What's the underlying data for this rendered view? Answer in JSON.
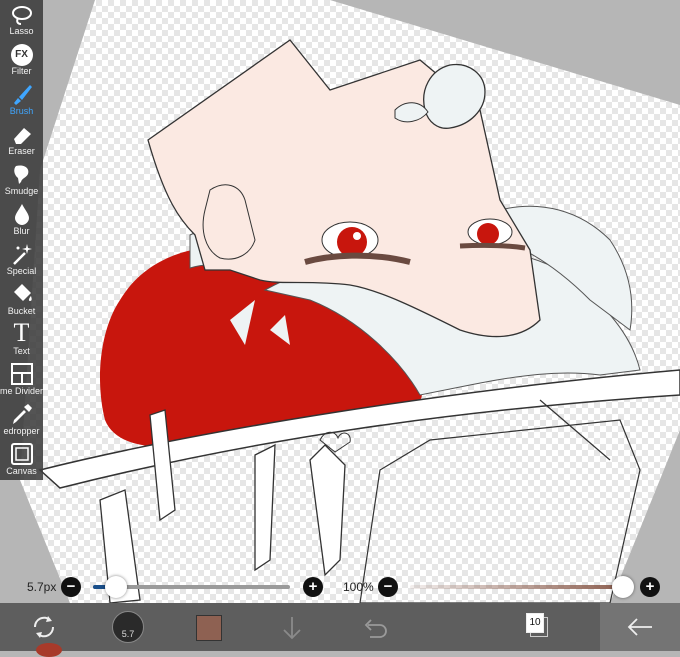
{
  "toolbar": {
    "items": [
      {
        "label": "Lasso",
        "icon": "lasso-icon"
      },
      {
        "label": "Filter",
        "icon": "fx-icon",
        "glyph": "FX"
      },
      {
        "label": "Brush",
        "icon": "brush-icon",
        "active": true
      },
      {
        "label": "Eraser",
        "icon": "eraser-icon"
      },
      {
        "label": "Smudge",
        "icon": "smudge-icon"
      },
      {
        "label": "Blur",
        "icon": "blur-icon"
      },
      {
        "label": "Special",
        "icon": "magic-wand-icon"
      },
      {
        "label": "Bucket",
        "icon": "bucket-icon"
      },
      {
        "label": "Text",
        "icon": "text-icon",
        "glyph": "T"
      },
      {
        "label": "me Divider",
        "icon": "frame-divider-icon"
      },
      {
        "label": "edropper",
        "icon": "eyedropper-icon"
      },
      {
        "label": "Canvas",
        "icon": "canvas-icon"
      }
    ],
    "active_color": "#3fa6ff"
  },
  "brush_size": {
    "label": "5.7px",
    "value": 5.7,
    "minus": "−",
    "plus": "+"
  },
  "opacity": {
    "label": "100%",
    "value": 100,
    "minus": "−",
    "plus": "+"
  },
  "bottom_bar": {
    "brush_preview_value": "5.7",
    "current_color": "#8e6152",
    "layer_count": "10"
  },
  "colors": {
    "toolbar_bg": "#3c3c3c",
    "hair_red": "#c8160d",
    "hair_white": "#eef3f4",
    "skin": "#fbe9e2",
    "eye_red": "#c8160d"
  }
}
